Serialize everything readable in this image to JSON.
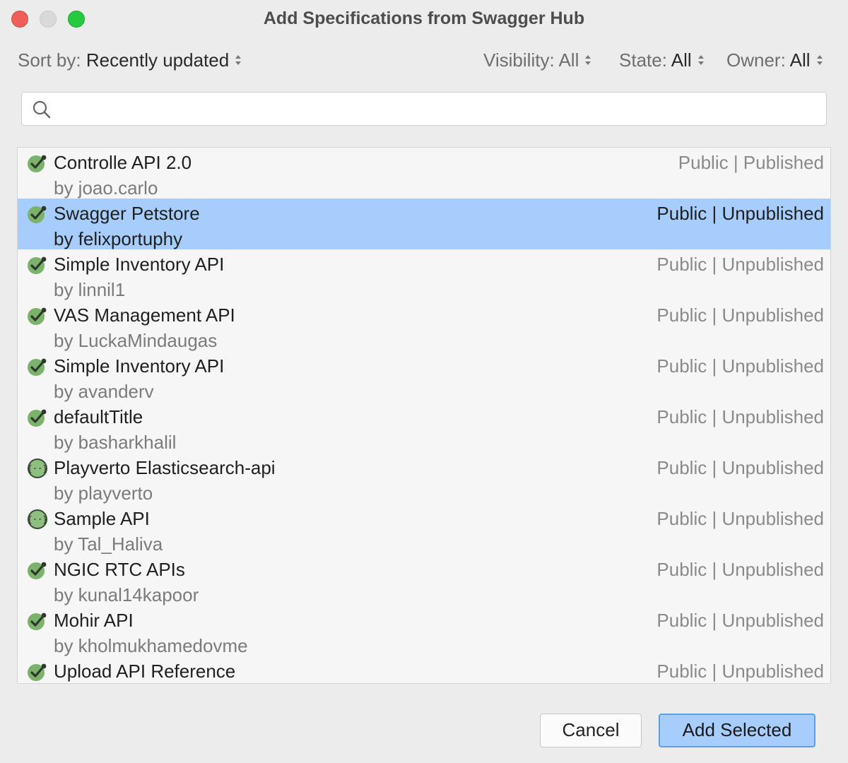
{
  "window": {
    "title": "Add Specifications from Swagger Hub"
  },
  "filters": {
    "sort": {
      "label": "Sort by:",
      "value": "Recently updated"
    },
    "visibility": {
      "label": "Visibility:",
      "value": "All"
    },
    "state": {
      "label": "State:",
      "value": "All"
    },
    "owner": {
      "label": "Owner:",
      "value": "All"
    }
  },
  "search": {
    "value": "",
    "placeholder": ""
  },
  "list": {
    "selected_index": 1,
    "items": [
      {
        "name": "Controlle API 2.0",
        "owner": "by joao.carlo",
        "status": "Public | Published",
        "icon": "openapi-check-icon"
      },
      {
        "name": "Swagger Petstore",
        "owner": "by felixportuphy",
        "status": "Public | Unpublished",
        "icon": "openapi-check-icon"
      },
      {
        "name": "Simple Inventory API",
        "owner": "by linnil1",
        "status": "Public | Unpublished",
        "icon": "openapi-check-icon"
      },
      {
        "name": "VAS Management API",
        "owner": "by LuckaMindaugas",
        "status": "Public | Unpublished",
        "icon": "openapi-check-icon"
      },
      {
        "name": "Simple Inventory API",
        "owner": "by avanderv",
        "status": "Public | Unpublished",
        "icon": "openapi-check-icon"
      },
      {
        "name": "defaultTitle",
        "owner": "by basharkhalil",
        "status": "Public | Unpublished",
        "icon": "openapi-check-icon"
      },
      {
        "name": "Playverto Elasticsearch-api",
        "owner": "by playverto",
        "status": "Public | Unpublished",
        "icon": "swagger-braces-icon"
      },
      {
        "name": "Sample API",
        "owner": "by Tal_Haliva",
        "status": "Public | Unpublished",
        "icon": "swagger-braces-icon"
      },
      {
        "name": "NGIC RTC APIs",
        "owner": "by kunal14kapoor",
        "status": "Public | Unpublished",
        "icon": "openapi-check-icon"
      },
      {
        "name": "Mohir API",
        "owner": "by kholmukhamedovme",
        "status": "Public | Unpublished",
        "icon": "openapi-check-icon"
      },
      {
        "name": "Upload API Reference",
        "owner": "",
        "status": "Public | Unpublished",
        "icon": "openapi-check-icon"
      }
    ]
  },
  "buttons": {
    "cancel": "Cancel",
    "add_selected": "Add Selected"
  },
  "colors": {
    "selection": "#a6cdfb",
    "default_button_border": "#5d9ee6",
    "icon_green": "#7cb26b"
  }
}
